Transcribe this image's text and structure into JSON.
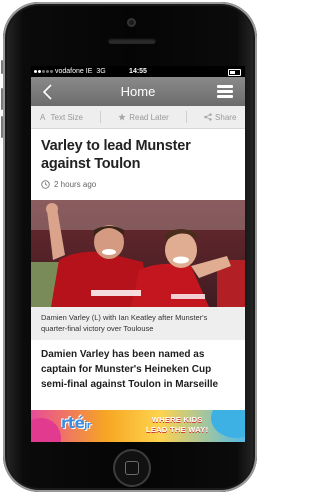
{
  "status_bar": {
    "carrier": "vodafone IE",
    "network": "3G",
    "time": "14:55"
  },
  "navbar": {
    "title": "Home",
    "back_icon": "chevron-left-icon",
    "menu_icon": "hamburger-menu-icon"
  },
  "toolbar": {
    "text_size_label": "Text Size",
    "read_later_label": "Read Later",
    "share_label": "Share"
  },
  "article": {
    "headline": "Varley to lead Munster against Toulon",
    "timestamp": "2 hours ago",
    "photo_caption": "Damien Varley (L) with Ian Keatley after Munster's quarter-final victory over Toulouse",
    "lead": "Damien Varley has been named as captain for Munster's Heineken Cup semi-final against Toulon in Marseille"
  },
  "ad": {
    "logo": "rté",
    "logo_sub": "jr",
    "slogan_line1": "WHERE KIDS",
    "slogan_line2": "LEAD THE WAY!"
  },
  "colors": {
    "navbar": "#7a7a7a",
    "jersey": "#b5121b",
    "toolbar_bg": "#eeeeee"
  }
}
